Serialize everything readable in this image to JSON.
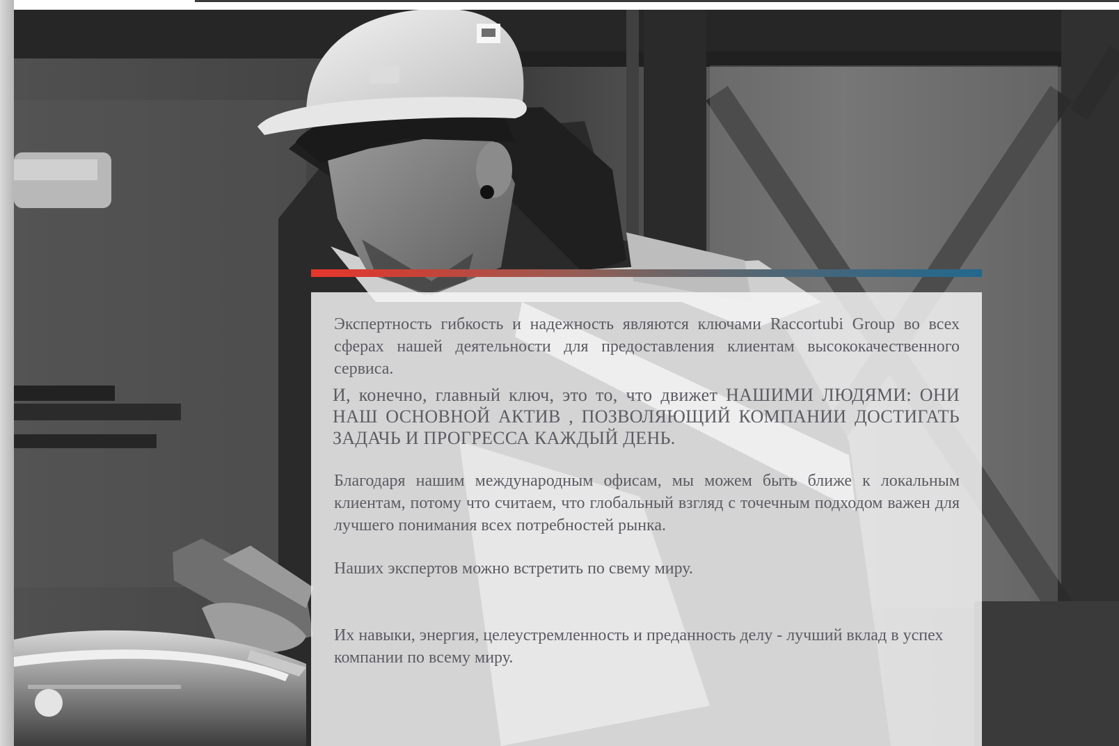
{
  "colors": {
    "accent_red": "#e7362b",
    "accent_blue": "#22688e",
    "text": "#5b5b62"
  },
  "photo": {
    "subject": "worker-in-hard-hat",
    "style": "black-and-white"
  },
  "content": {
    "paragraph_1": "Экспертность гибкость и надежность являются ключами Raccortubi Group во всех сферах нашей деятельности для предоставления  клиентам высококачественного сервиса.",
    "paragraph_2": "И, конечно, главный ключ, это то, что движет НАШИМИ ЛЮДЯМИ: ОНИ НАШ ОСНОВНОЙ АКТИВ , ПОЗВОЛЯЮЩИЙ КОМПАНИИ ДОСТИГАТЬ ЗАДАЧЬ И ПРОГРЕССА КАЖДЫЙ ДЕНЬ.",
    "paragraph_3": "Благодаря нашим международным офисам, мы можем быть ближе к локальным клиентам, потому что считаем, что глобальный взгляд с точечным подходом важен для лучшего понимания всех потребностей рынка.",
    "paragraph_4": "Наших экспертов можно встретить по свему миру.",
    "paragraph_5": "Их навыки, энергия, целеустремленность и преданность делу - лучший вклад в успех компании по всему миру."
  }
}
